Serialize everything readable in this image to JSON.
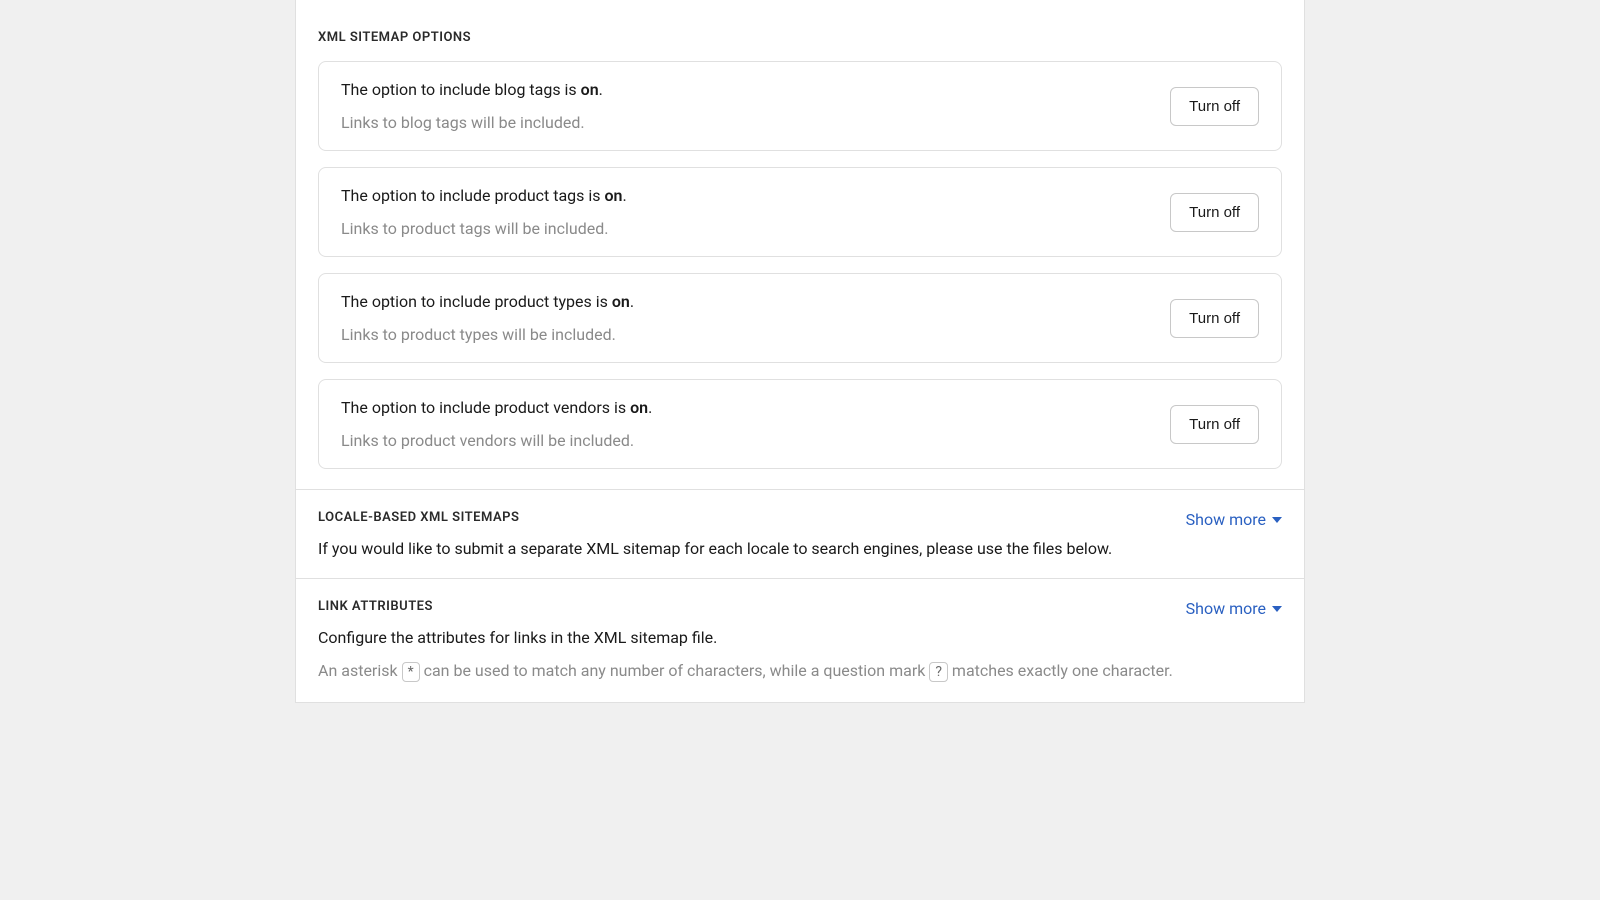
{
  "sitemap_options": {
    "title": "XML SITEMAP OPTIONS",
    "items": [
      {
        "prefix": "The option to include blog tags is ",
        "state": "on",
        "suffix": ".",
        "desc": "Links to blog tags will be included.",
        "button": "Turn off"
      },
      {
        "prefix": "The option to include product tags is ",
        "state": "on",
        "suffix": ".",
        "desc": "Links to product tags will be included.",
        "button": "Turn off"
      },
      {
        "prefix": "The option to include product types is ",
        "state": "on",
        "suffix": ".",
        "desc": "Links to product types will be included.",
        "button": "Turn off"
      },
      {
        "prefix": "The option to include product vendors is ",
        "state": "on",
        "suffix": ".",
        "desc": "Links to product vendors will be included.",
        "button": "Turn off"
      }
    ]
  },
  "locale_sitemaps": {
    "title": "LOCALE-BASED XML SITEMAPS",
    "show_more": "Show more",
    "desc": "If you would like to submit a separate XML sitemap for each locale to search engines, please use the files below."
  },
  "link_attributes": {
    "title": "LINK ATTRIBUTES",
    "show_more": "Show more",
    "desc": "Configure the attributes for links in the XML sitemap file.",
    "hint_parts": {
      "p1": "An asterisk ",
      "k1": "*",
      "p2": " can be used to match any number of characters, while a question mark ",
      "k2": "?",
      "p3": " matches exactly one character."
    }
  }
}
